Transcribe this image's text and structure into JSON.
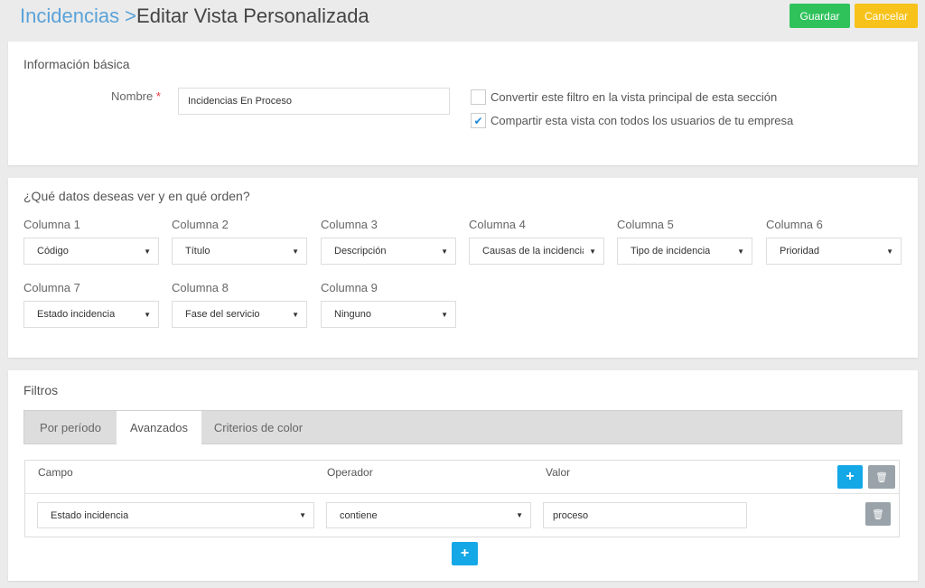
{
  "header": {
    "breadcrumb_link": "Incidencias >",
    "title": "Editar Vista Personalizada",
    "save_label": "Guardar",
    "cancel_label": "Cancelar"
  },
  "basic": {
    "title": "Información básica",
    "name_label": "Nombre",
    "required_mark": "*",
    "name_value": "Incidencias En Proceso",
    "checkbox1": {
      "label": "Convertir este filtro en la vista principal de esta sección",
      "checked": false
    },
    "checkbox2": {
      "label": "Compartir esta vista con todos los usuarios de tu empresa",
      "checked": true
    }
  },
  "columns": {
    "title": "¿Qué datos deseas ver y en qué orden?",
    "items": [
      {
        "label": "Columna 1",
        "value": "Código"
      },
      {
        "label": "Columna 2",
        "value": "Título"
      },
      {
        "label": "Columna 3",
        "value": "Descripción"
      },
      {
        "label": "Columna 4",
        "value": "Causas de la incidencia"
      },
      {
        "label": "Columna 5",
        "value": "Tipo de incidencia"
      },
      {
        "label": "Columna 6",
        "value": "Prioridad"
      },
      {
        "label": "Columna 7",
        "value": "Estado incidencia"
      },
      {
        "label": "Columna 8",
        "value": "Fase del servicio"
      },
      {
        "label": "Columna 9",
        "value": "Ninguno"
      }
    ]
  },
  "filters": {
    "title": "Filtros",
    "tabs": [
      "Por período",
      "Avanzados",
      "Criterios de color"
    ],
    "active_tab": "Avanzados",
    "headers": {
      "field": "Campo",
      "operator": "Operador",
      "value": "Valor"
    },
    "row": {
      "field": "Estado incidencia",
      "operator": "contiene",
      "value": "proceso"
    }
  },
  "icons": {
    "caret": "▼",
    "check": "✔",
    "plus": "+",
    "trash": "🗑"
  },
  "colors": {
    "accent_blue": "#5aa2d8",
    "save_green": "#2fc25b",
    "cancel_yellow": "#f7c21a",
    "action_blue": "#14a8e6",
    "trash_gray": "#99a3a9"
  }
}
